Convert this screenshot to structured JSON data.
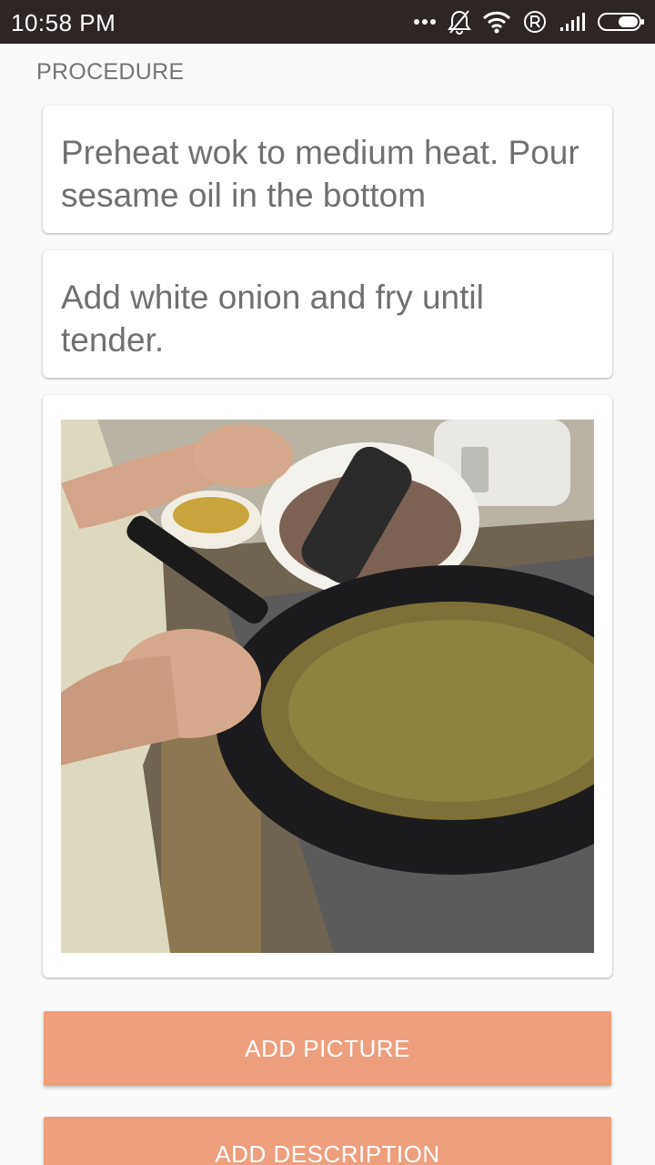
{
  "status_bar": {
    "time": "10:58 PM",
    "icons": [
      "more-dots-icon",
      "silent-bell-icon",
      "wifi-icon",
      "registered-icon",
      "signal-icon",
      "battery-icon"
    ]
  },
  "section": {
    "label": "PROCEDURE"
  },
  "steps": [
    {
      "text": "Preheat wok to medium heat. Pour sesame oil in the bottom"
    },
    {
      "text": "Add white onion and fry until tender."
    }
  ],
  "image_card": {
    "content": "cooking-photo"
  },
  "buttons": {
    "add_picture": "ADD PICTURE",
    "add_description": "ADD DESCRIPTION"
  },
  "colors": {
    "status_bar": "#2e2624",
    "background": "#fafafa",
    "button": "#ee9f7c",
    "step_text": "#707070",
    "label_text": "#757575"
  }
}
